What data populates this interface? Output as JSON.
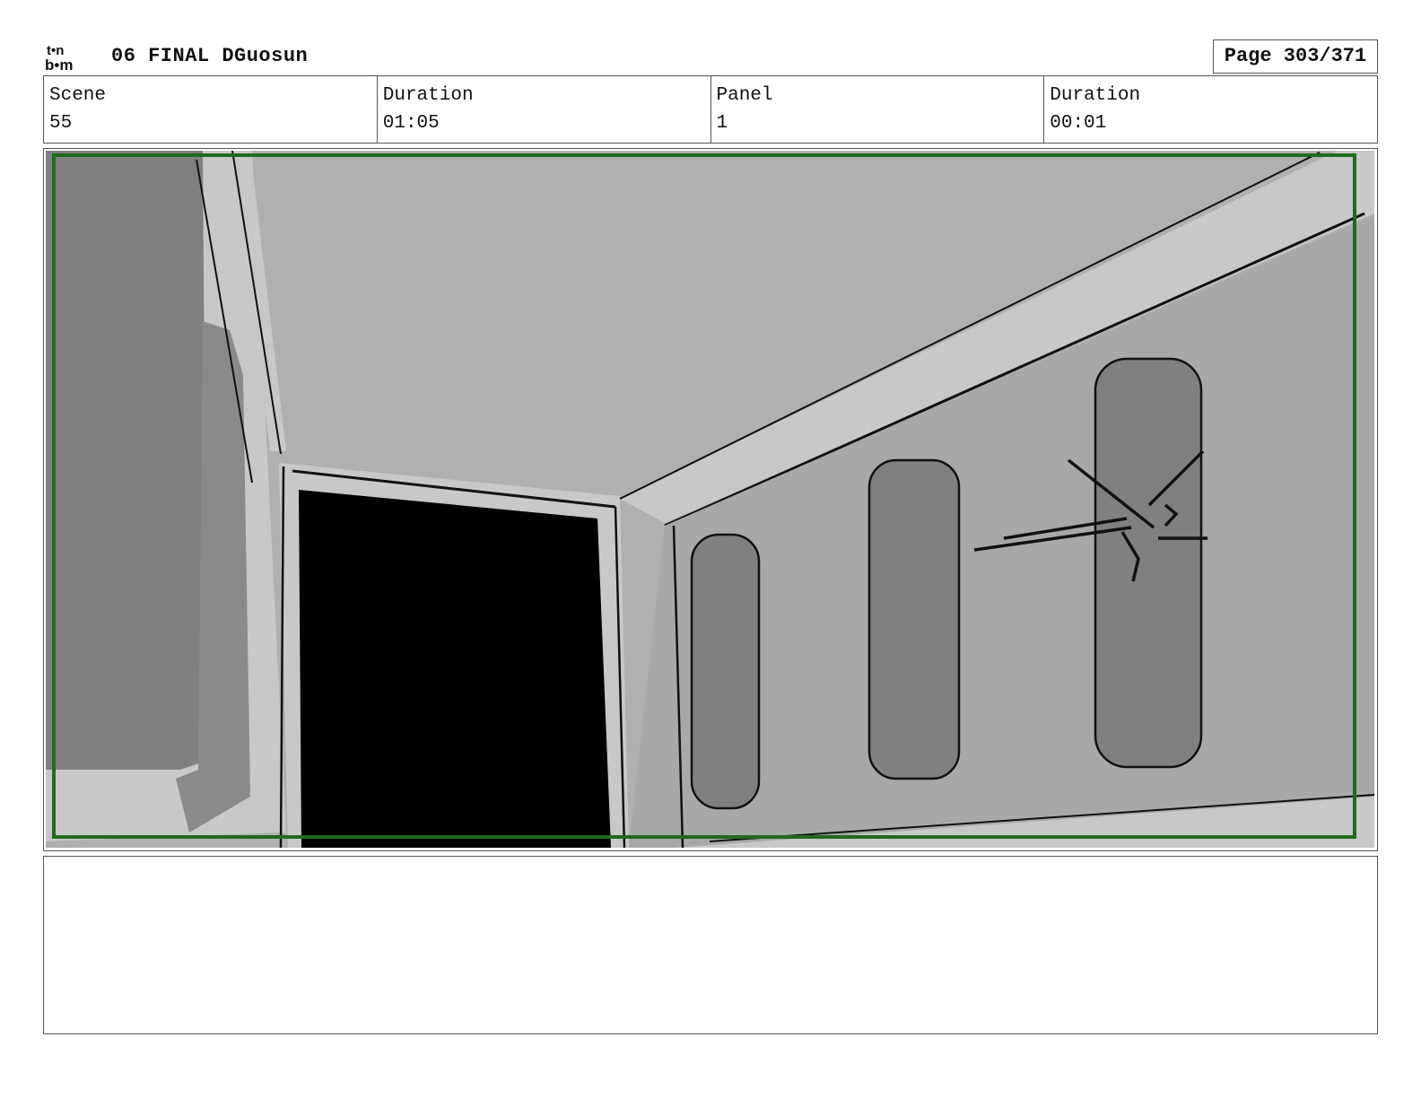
{
  "header": {
    "logo_top": "t•n",
    "logo_bottom": "b•m",
    "title": "06 FINAL DGuosun",
    "page_label": "Page 303/371"
  },
  "info": {
    "scene_label": "Scene",
    "scene_value": "55",
    "scene_duration_label": "Duration",
    "scene_duration_value": "01:05",
    "panel_label": "Panel",
    "panel_value": "1",
    "panel_duration_label": "Duration",
    "panel_duration_value": "00:01"
  },
  "notes": {
    "text": ""
  },
  "colors": {
    "safe_frame": "#1f6b1f",
    "border": "#555555"
  }
}
